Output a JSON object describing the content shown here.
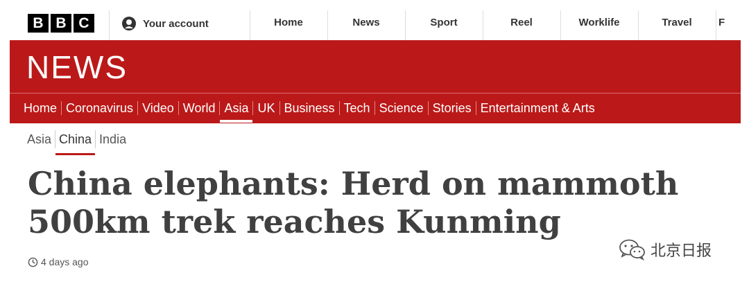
{
  "brand": {
    "letters": [
      "B",
      "B",
      "C"
    ]
  },
  "account": {
    "label": "Your account"
  },
  "top_nav": [
    "Home",
    "News",
    "Sport",
    "Reel",
    "Worklife",
    "Travel",
    "F"
  ],
  "section": {
    "title": "NEWS"
  },
  "main_nav": {
    "items": [
      "Home",
      "Coronavirus",
      "Video",
      "World",
      "Asia",
      "UK",
      "Business",
      "Tech",
      "Science",
      "Stories",
      "Entertainment & Arts"
    ],
    "active": "Asia"
  },
  "sub_nav": {
    "items": [
      "Asia",
      "China",
      "India"
    ],
    "active": "China"
  },
  "article": {
    "headline": "China elephants: Herd on mammoth 500km trek reaches Kunming",
    "timestamp": "4 days ago"
  },
  "watermark": {
    "text": "北京日报"
  },
  "colors": {
    "brand_red": "#bb1919",
    "headline": "#404040"
  },
  "icons": [
    "account-icon",
    "clock-icon",
    "wechat-icon"
  ]
}
